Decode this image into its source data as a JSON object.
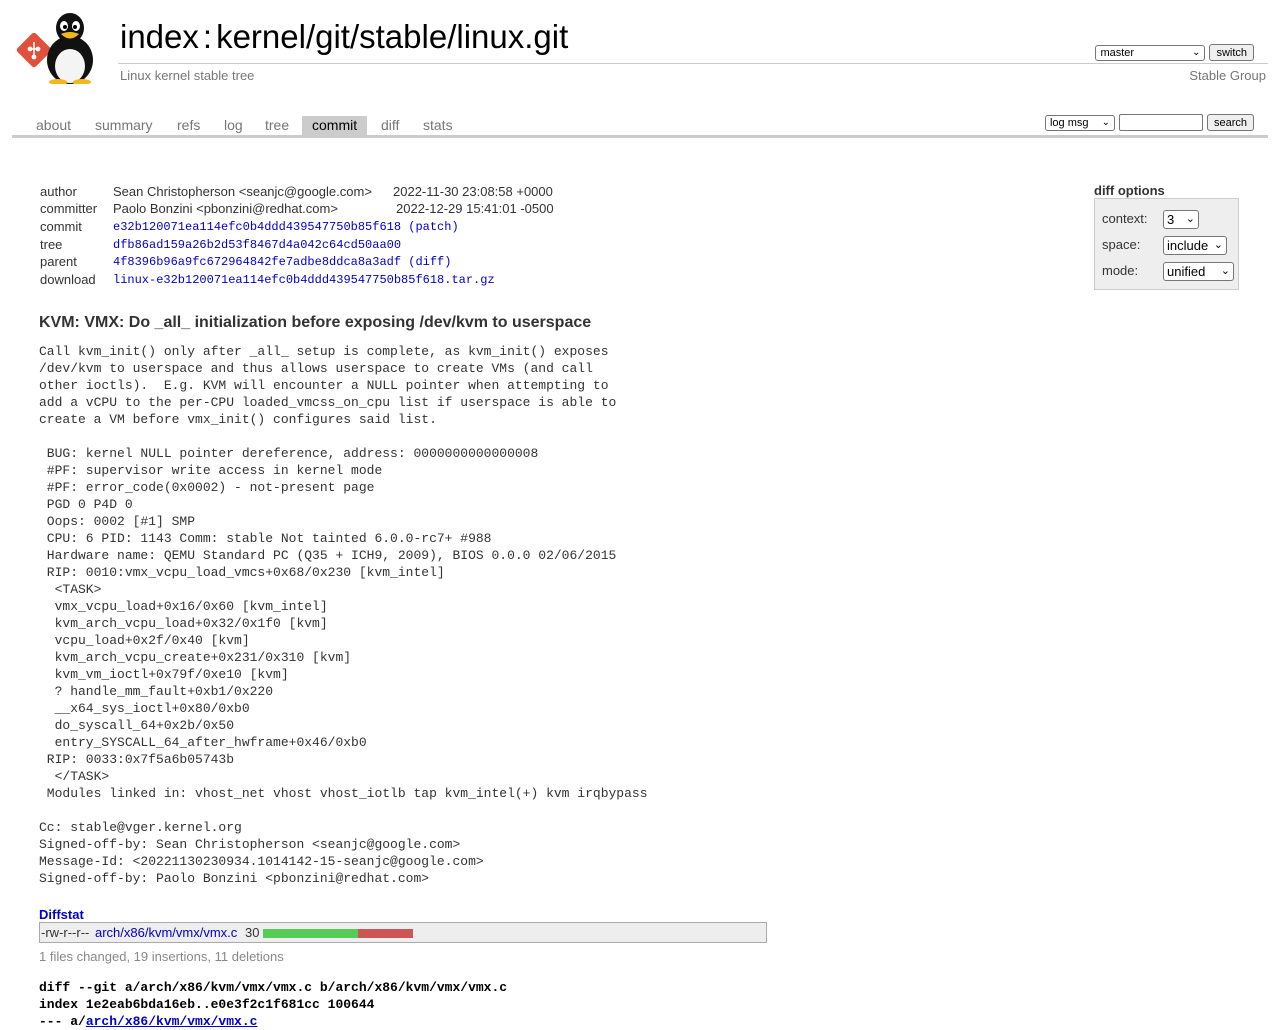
{
  "header": {
    "title_index": "index",
    "title_sep": ":",
    "repo_path": "kernel/git/stable/linux.git",
    "subtitle": "Linux kernel stable tree",
    "owner": "Stable Group",
    "branch_select": "master",
    "switch_label": "switch"
  },
  "tabs": [
    {
      "label": "about",
      "active": false
    },
    {
      "label": "summary",
      "active": false
    },
    {
      "label": "refs",
      "active": false
    },
    {
      "label": "log",
      "active": false
    },
    {
      "label": "tree",
      "active": false
    },
    {
      "label": "commit",
      "active": true
    },
    {
      "label": "diff",
      "active": false
    },
    {
      "label": "stats",
      "active": false
    }
  ],
  "search": {
    "mode_select": "log msg",
    "query": "",
    "button_label": "search"
  },
  "commit_info": {
    "author_label": "author",
    "author": "Sean Christopherson <seanjc@google.com>",
    "author_date": "2022-11-30 23:08:58 +0000",
    "committer_label": "committer",
    "committer": "Paolo Bonzini <pbonzini@redhat.com>",
    "committer_date": "2022-12-29 15:41:01 -0500",
    "commit_label": "commit",
    "commit_hash": "e32b120071ea114efc0b4ddd439547750b85f618",
    "patch_link": "(patch)",
    "tree_label": "tree",
    "tree_hash": "dfb86ad159a26b2d53f8467d4a042c64cd50aa00",
    "parent_label": "parent",
    "parent_hash": "4f8396b96a9fc672964842fe7adbe8ddca8a3adf",
    "diff_link": "(diff)",
    "download_label": "download",
    "download_file": "linux-e32b120071ea114efc0b4ddd439547750b85f618.tar.gz"
  },
  "diff_options": {
    "title": "diff options",
    "context_label": "context:",
    "context_value": "3",
    "space_label": "space:",
    "space_value": "include",
    "mode_label": "mode:",
    "mode_value": "unified"
  },
  "subject": "KVM: VMX: Do _all_ initialization before exposing /dev/kvm to userspace",
  "message": "Call kvm_init() only after _all_ setup is complete, as kvm_init() exposes\n/dev/kvm to userspace and thus allows userspace to create VMs (and call\nother ioctls).  E.g. KVM will encounter a NULL pointer when attempting to\nadd a vCPU to the per-CPU loaded_vmcss_on_cpu list if userspace is able to\ncreate a VM before vmx_init() configures said list.\n\n BUG: kernel NULL pointer dereference, address: 0000000000000008\n #PF: supervisor write access in kernel mode\n #PF: error_code(0x0002) - not-present page\n PGD 0 P4D 0\n Oops: 0002 [#1] SMP\n CPU: 6 PID: 1143 Comm: stable Not tainted 6.0.0-rc7+ #988\n Hardware name: QEMU Standard PC (Q35 + ICH9, 2009), BIOS 0.0.0 02/06/2015\n RIP: 0010:vmx_vcpu_load_vmcs+0x68/0x230 [kvm_intel]\n  <TASK>\n  vmx_vcpu_load+0x16/0x60 [kvm_intel]\n  kvm_arch_vcpu_load+0x32/0x1f0 [kvm]\n  vcpu_load+0x2f/0x40 [kvm]\n  kvm_arch_vcpu_create+0x231/0x310 [kvm]\n  kvm_vm_ioctl+0x79f/0xe10 [kvm]\n  ? handle_mm_fault+0xb1/0x220\n  __x64_sys_ioctl+0x80/0xb0\n  do_syscall_64+0x2b/0x50\n  entry_SYSCALL_64_after_hwframe+0x46/0xb0\n RIP: 0033:0x7f5a6b05743b\n  </TASK>\n Modules linked in: vhost_net vhost vhost_iotlb tap kvm_intel(+) kvm irqbypass\n\nCc: stable@vger.kernel.org\nSigned-off-by: Sean Christopherson <seanjc@google.com>\nMessage-Id: <20221130230934.1014142-15-seanjc@google.com>\nSigned-off-by: Paolo Bonzini <pbonzini@redhat.com>",
  "diffstat": {
    "header": "Diffstat",
    "mode": "-rw-r--r--",
    "file": "arch/x86/kvm/vmx/vmx.c",
    "changes": "30",
    "insertions": 19,
    "deletions": 11,
    "summary": "1 files changed, 19 insertions, 11 deletions",
    "insert_color": "#55cc55",
    "delete_color": "#cc5555"
  },
  "diff_head": {
    "line1": "diff --git a/arch/x86/kvm/vmx/vmx.c b/arch/x86/kvm/vmx/vmx.c",
    "line2": "index 1e2eab6bda16eb..e0e3f2c1f681cc 100644",
    "line3_prefix": "--- a/",
    "line3_path": "arch/x86/kvm/vmx/vmx.c"
  }
}
